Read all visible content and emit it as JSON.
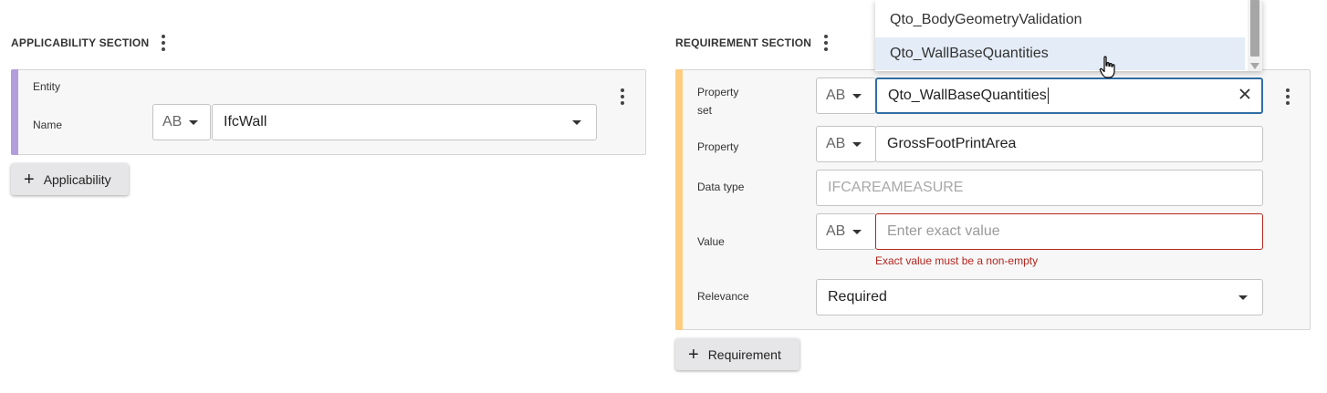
{
  "applicability": {
    "title": "APPLICABILITY SECTION",
    "card": {
      "accent_color": "#b39ddb",
      "entity_label": "Entity",
      "name_label": "Name",
      "type_selector": "AB",
      "name_value": "IfcWall"
    },
    "add_button": "Applicability"
  },
  "requirement": {
    "title": "REQUIREMENT SECTION",
    "card": {
      "accent_color": "#ffcc80",
      "property_set_label_line1": "Property",
      "property_set_label_line2": "set",
      "property_set_type": "AB",
      "property_set_value": "Qto_WallBaseQuantities",
      "property_label": "Property",
      "property_type": "AB",
      "property_value": "GrossFootPrintArea",
      "data_type_label": "Data type",
      "data_type_value": "IFCAREAMEASURE",
      "value_label": "Value",
      "value_type": "AB",
      "value_placeholder": "Enter exact value",
      "value_error": "Exact value must be a non-empty",
      "relevance_label": "Relevance",
      "relevance_value": "Required"
    },
    "add_button": "Requirement"
  },
  "autocomplete": {
    "options": [
      {
        "label": "Qto_BodyGeometryValidation",
        "selected": false
      },
      {
        "label": "Qto_WallBaseQuantities",
        "selected": true
      }
    ]
  },
  "colors": {
    "focus_border": "#2f6ea3",
    "error": "#b3261e",
    "selected_option_bg": "#e3ecf7"
  }
}
